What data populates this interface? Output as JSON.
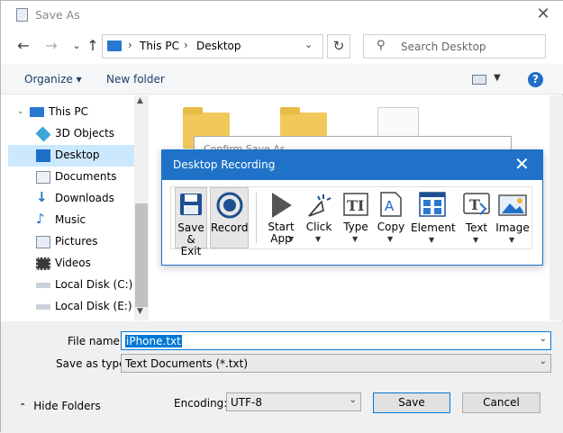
{
  "window": {
    "title": "Save As"
  },
  "address": {
    "parts": [
      "This PC",
      "Desktop"
    ],
    "separator": "›"
  },
  "search": {
    "placeholder": "Search Desktop"
  },
  "toolbar": {
    "organize": "Organize ▾",
    "new_folder": "New folder",
    "help": "?"
  },
  "sidebar": {
    "items": [
      {
        "label": "This PC",
        "icon": "pc-icon"
      },
      {
        "label": "3D Objects",
        "icon": "cube-icon"
      },
      {
        "label": "Desktop",
        "icon": "desktop-icon",
        "selected": true
      },
      {
        "label": "Documents",
        "icon": "documents-icon"
      },
      {
        "label": "Downloads",
        "icon": "download-icon"
      },
      {
        "label": "Music",
        "icon": "music-icon"
      },
      {
        "label": "Pictures",
        "icon": "pictures-icon"
      },
      {
        "label": "Videos",
        "icon": "videos-icon"
      },
      {
        "label": "Local Disk (C:)",
        "icon": "disk-icon"
      },
      {
        "label": "Local Disk (E:)",
        "icon": "disk-icon"
      }
    ]
  },
  "confirm": {
    "title": "Confirm Save As"
  },
  "form": {
    "file_name_label": "File name:",
    "file_name_value": "iPhone.txt",
    "save_type_label": "Save as type:",
    "save_type_value": "Text Documents (*.txt)",
    "encoding_label": "Encoding:",
    "encoding_value": "UTF-8"
  },
  "buttons": {
    "save": "Save",
    "cancel": "Cancel",
    "hide_folders": "Hide Folders"
  },
  "recorder": {
    "title": "Desktop Recording",
    "tools": {
      "save_exit_line1": "Save",
      "save_exit_line2": "& Exit",
      "record": "Record",
      "start_app_line1": "Start",
      "start_app_line2": "App",
      "click": "Click",
      "type": "Type",
      "copy": "Copy",
      "element": "Element",
      "text": "Text",
      "image": "Image"
    }
  },
  "colors": {
    "accent": "#1f72c8",
    "selection": "#0078d7",
    "folder": "#f1c85a"
  }
}
